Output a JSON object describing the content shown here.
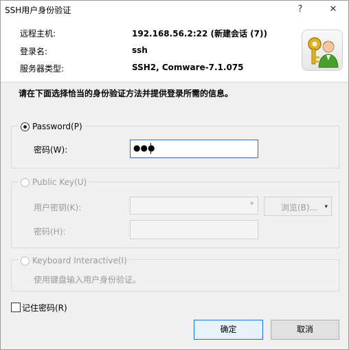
{
  "window": {
    "title": "SSH用户身份验证",
    "help_glyph": "?",
    "close_glyph": "✕"
  },
  "header": {
    "remote_host_label": "远程主机:",
    "remote_host_value": "192.168.56.2:22 (新建会话 (7))",
    "login_label": "登录名:",
    "login_value": "ssh",
    "server_type_label": "服务器类型:",
    "server_type_value": "SSH2, Comware-7.1.075",
    "icon": "user-key-icon"
  },
  "instruction": "请在下面选择恰当的身份验证方法并提供登录所需的信息。",
  "methods": {
    "password": {
      "label": "Password(P)",
      "selected": true,
      "field_label": "密码(W):",
      "value": "●●●"
    },
    "public_key": {
      "label": "Public Key(U)",
      "selected": false,
      "key_label": "用户密钥(K):",
      "key_value": "",
      "browse_label": "浏览(B)...",
      "passphrase_label": "密码(H):"
    },
    "keyboard_interactive": {
      "label": "Keyboard Interactive(I)",
      "selected": false,
      "description": "使用键盘输入用户身份验证。"
    }
  },
  "remember_password": {
    "label": "记住密码(R)",
    "checked": false
  },
  "buttons": {
    "ok": "确定",
    "cancel": "取消"
  },
  "colors": {
    "focus_border": "#1c6fd1",
    "disabled_text": "#9a9a9a"
  }
}
